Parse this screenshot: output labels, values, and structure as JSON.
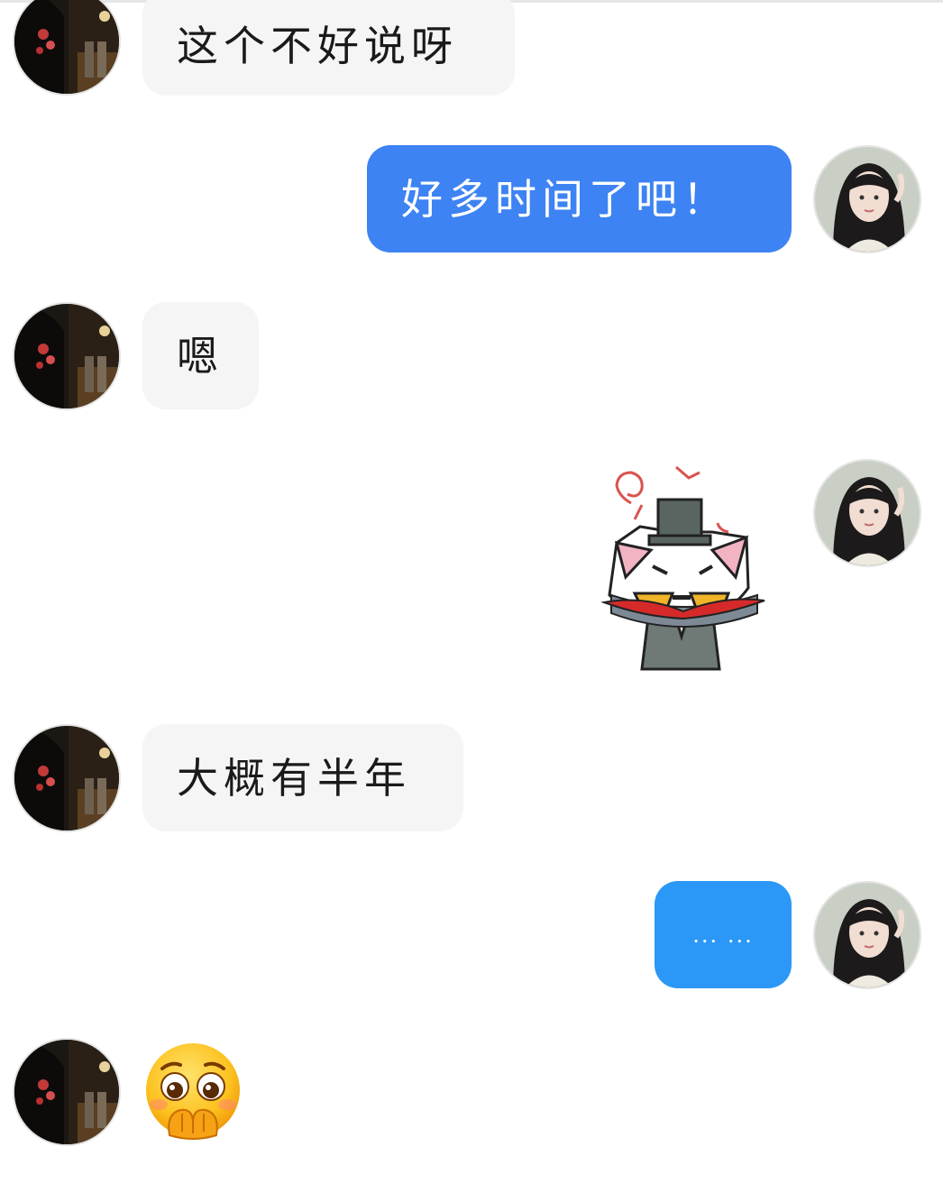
{
  "messages": [
    {
      "side": "in",
      "text": "这个不好说呀"
    },
    {
      "side": "out",
      "text": "好多时间了吧！"
    },
    {
      "side": "in",
      "text": "嗯"
    },
    {
      "side": "out",
      "sticker": "cat-with-top-hat-sticker"
    },
    {
      "side": "in",
      "text": "大概有半年"
    },
    {
      "side": "out",
      "text": "... ..."
    },
    {
      "side": "in",
      "emoji": "flushed-face-hands-emoji"
    }
  ],
  "colors": {
    "incoming_bubble": "#f5f5f5",
    "outgoing_bubble": "#3d83f3",
    "outgoing_bubble_alt": "#2b98f7",
    "incoming_text": "#1a1a1a",
    "outgoing_text": "#ffffff"
  }
}
